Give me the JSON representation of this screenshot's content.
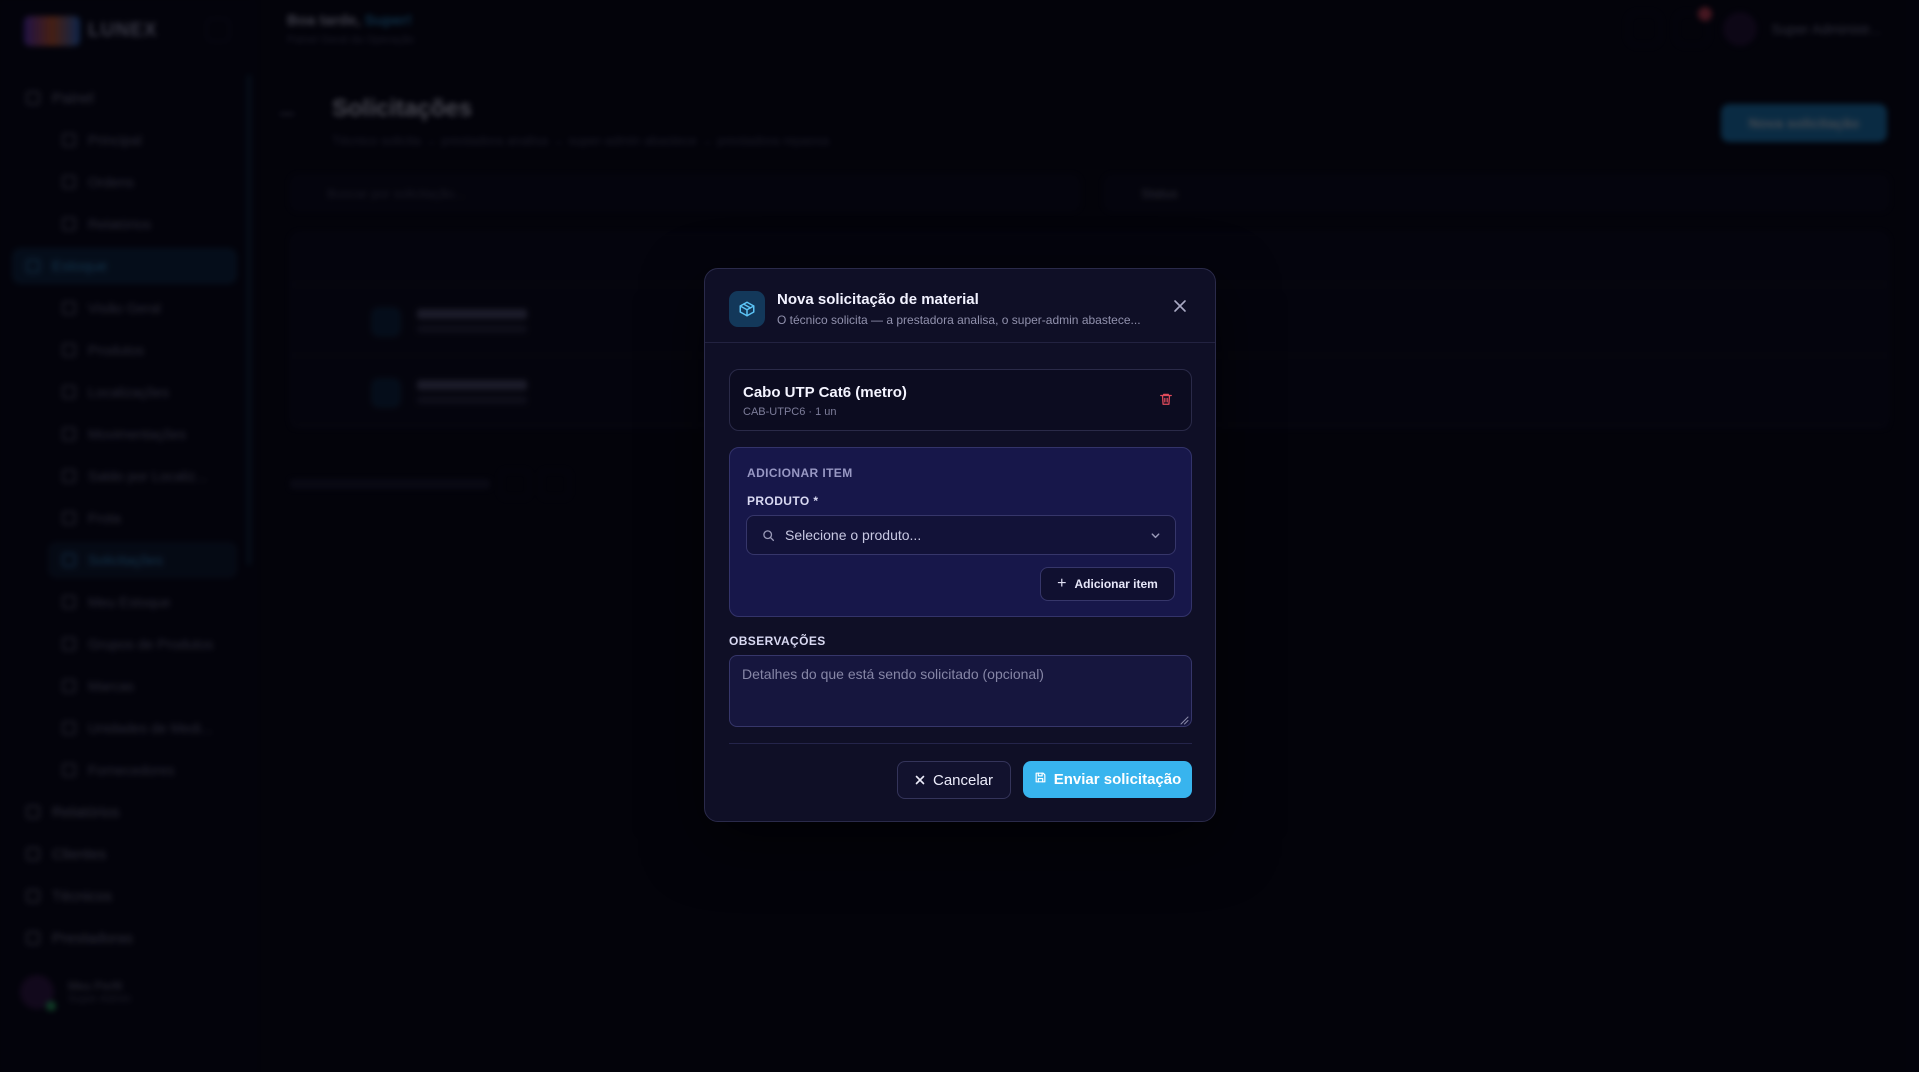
{
  "background": {
    "brand_name": "LUNEX",
    "greeting": "Boa tarde,",
    "greeting_name": "Super!",
    "greeting_sub": "Painel Geral da Operação",
    "top_user_name": "Super Administr...",
    "sidebar_user": "Meu Perfil",
    "sidebar_user_sub": "Super Admin",
    "nav": [
      {
        "label": "Painel",
        "type": "group"
      },
      {
        "label": "Principal",
        "type": "sub"
      },
      {
        "label": "Ordens",
        "type": "sub"
      },
      {
        "label": "Relatórios",
        "type": "sub"
      },
      {
        "label": "Estoque",
        "type": "group-active"
      },
      {
        "label": "Visão Geral",
        "type": "sub"
      },
      {
        "label": "Produtos",
        "type": "sub"
      },
      {
        "label": "Localizações",
        "type": "sub"
      },
      {
        "label": "Movimentações",
        "type": "sub"
      },
      {
        "label": "Saldo por Localiz...",
        "type": "sub"
      },
      {
        "label": "Frota",
        "type": "sub"
      },
      {
        "label": "Solicitações",
        "type": "sub-active"
      },
      {
        "label": "Meu Estoque",
        "type": "sub"
      },
      {
        "label": "Grupos de Produtos",
        "type": "sub"
      },
      {
        "label": "Marcas",
        "type": "sub"
      },
      {
        "label": "Unidades de Medi...",
        "type": "sub"
      },
      {
        "label": "Fornecedores",
        "type": "sub"
      },
      {
        "label": "Relatórios",
        "type": "group"
      },
      {
        "label": "Clientes",
        "type": "group"
      },
      {
        "label": "Técnicos",
        "type": "group"
      },
      {
        "label": "Prestadoras",
        "type": "group"
      }
    ],
    "page_title": "Solicitações",
    "page_sub": "Técnico solicita → prestadora analisa → super-admin abastece → prestadora repassa",
    "new_button": "Nova solicitação",
    "search_placeholder": "Buscar por solicitação...",
    "status_filter": "Status"
  },
  "modal": {
    "title": "Nova solicitação de material",
    "subtitle": "O técnico solicita — a prestadora analisa, o super-admin abastece...",
    "item": {
      "name": "Cabo UTP Cat6 (metro)",
      "meta": "CAB-UTPC6 · 1 un"
    },
    "add_section": {
      "title": "ADICIONAR ITEM",
      "product_label": "PRODUTO *",
      "product_placeholder": "Selecione o produto...",
      "add_button": "Adicionar item"
    },
    "observations": {
      "label": "OBSERVAÇÕES",
      "placeholder": "Detalhes do que está sendo solicitado (opcional)",
      "value": ""
    },
    "cancel_label": "Cancelar",
    "submit_label": "Enviar solicitação"
  },
  "icons": {
    "modal_header": "package-icon",
    "close": "close-icon",
    "delete": "trash-icon",
    "search": "search-icon",
    "chevron": "chevron-down-icon",
    "plus": "plus-icon",
    "cancel": "x-icon",
    "save": "save-icon"
  },
  "colors": {
    "accent": "#38b4ee",
    "danger": "#e24b5b",
    "modal_bg": "#0f0f26",
    "add_box_bg": "#17174a"
  }
}
